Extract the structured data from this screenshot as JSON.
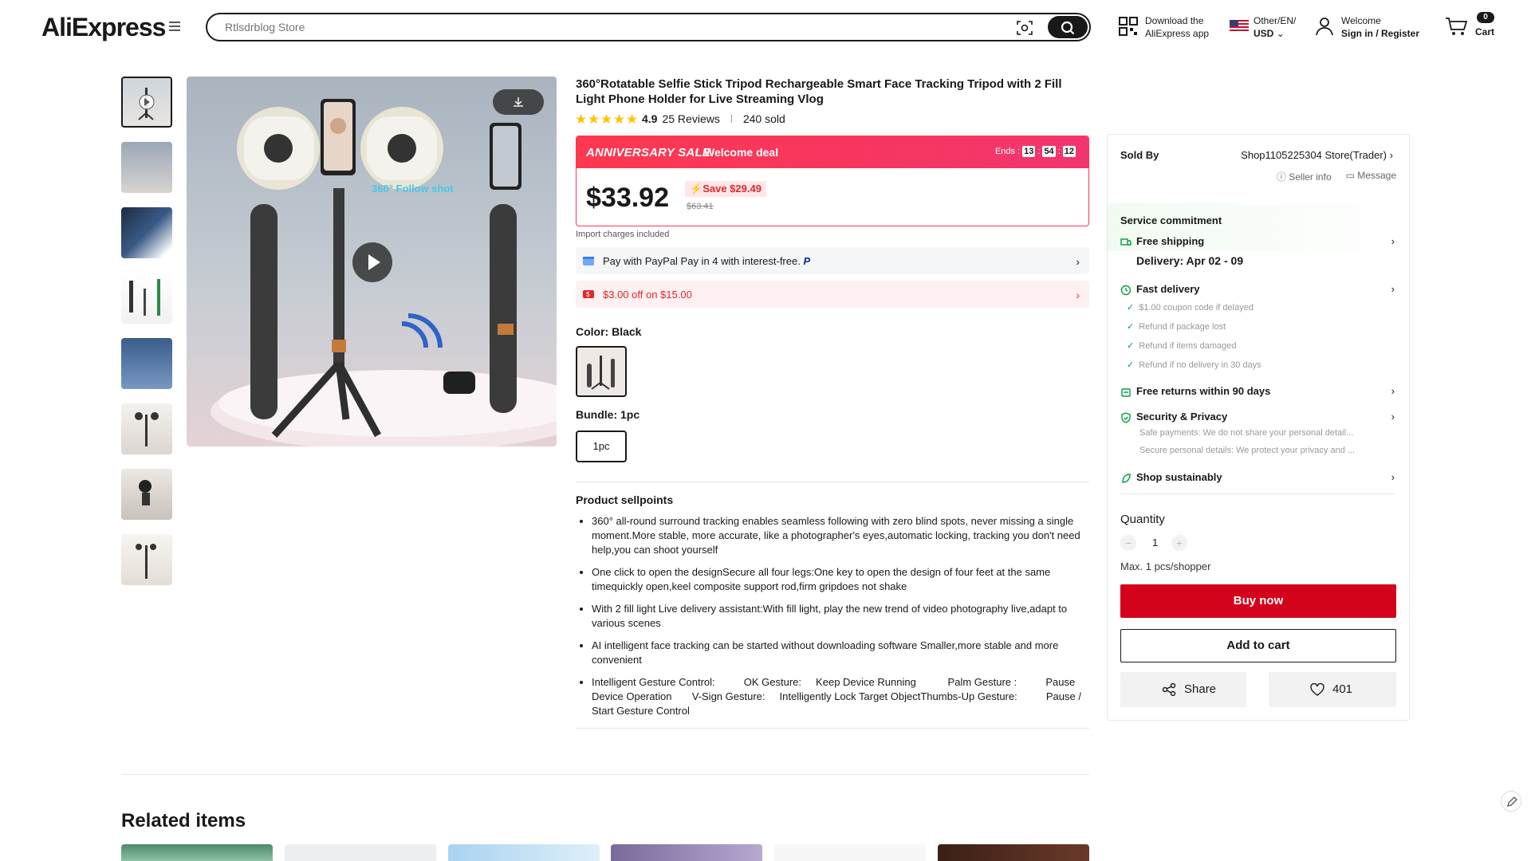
{
  "header": {
    "logo": "AliExpress",
    "search_placeholder": "Rtlsdrblog Store",
    "app_download_line1": "Download the",
    "app_download_line2": "AliExpress app",
    "lang_line1": "Other/EN/",
    "lang_line2": "USD",
    "welcome": "Welcome",
    "sign_in": "Sign in / Register",
    "cart_count": "0",
    "cart_label": "Cart"
  },
  "product": {
    "title": "360°Rotatable Selfie Stick Tripod Rechargeable Smart Face Tracking Tripod with 2 Fill Light Phone Holder for Live Streaming Vlog",
    "rating": "4.9",
    "reviews": "25 Reviews",
    "sold": "240 sold",
    "sale_title": "ANNIVERSARY SALE",
    "sale_deal": "Welcome deal",
    "ends_label": "Ends :",
    "countdown": [
      "13",
      "54",
      "12"
    ],
    "price": "$33.92",
    "save": "Save $29.49",
    "original_price": "$63.41",
    "import_note": "Import charges included",
    "paypal_text": "Pay with PayPal Pay in 4 with interest-free.",
    "coupon_text": "$3.00 off on $15.00",
    "color_label": "Color: Black",
    "bundle_label": "Bundle: 1pc",
    "bundle_option": "1pc",
    "sellpoints_title": "Product sellpoints",
    "sellpoints": [
      "360° all-round surround tracking enables seamless following with zero blind spots, never missing a single moment.More stable, more accurate, like a photographer's eyes,automatic locking, tracking you don't need help,you can shoot yourself",
      "One click to open the designSecure all four legs:One key to open the design of four feet at the same timequickly open,keel composite support rod,firm gripdoes not shake",
      "With 2 fill light Live delivery assistant:With fill light, play the new trend of video photography live,adapt to various scenes",
      "AI intelligent face tracking can be started without downloading  software Smaller,more stable and more convenient",
      "Intelligent Gesture Control:          OK Gesture:     Keep Device Running           Palm Gesture :          Pause Device Operation       V-Sign Gesture:     Intelligently Lock Target ObjectThumbs-Up Gesture:          Pause / Start Gesture Control"
    ]
  },
  "seller": {
    "sold_by": "Sold By",
    "store": "Shop1105225304 Store(Trader)",
    "seller_info": "Seller info",
    "message": "Message"
  },
  "service": {
    "heading": "Service commitment",
    "free_shipping": "Free shipping",
    "delivery": "Delivery: Apr 02 - 09",
    "fast_delivery": "Fast delivery",
    "fast_items": [
      "$1.00 coupon code if delayed",
      "Refund if package lost",
      "Refund if items damaged",
      "Refund if no delivery in 30 days"
    ],
    "free_returns": "Free returns within 90 days",
    "security": "Security & Privacy",
    "security_items": [
      "Safe payments: We do not share your personal detail...",
      "Secure personal details: We protect your privacy and ..."
    ],
    "sustain": "Shop sustainably"
  },
  "purchase": {
    "qty_label": "Quantity",
    "qty_value": "1",
    "max_note": "Max. 1 pcs/shopper",
    "buy_now": "Buy now",
    "add_cart": "Add to cart",
    "share": "Share",
    "wishlist": "401"
  },
  "related": {
    "title": "Related items"
  },
  "colors": {
    "sale_red": "#fd384f",
    "buy_red": "#d3031c",
    "green": "#00a040"
  }
}
